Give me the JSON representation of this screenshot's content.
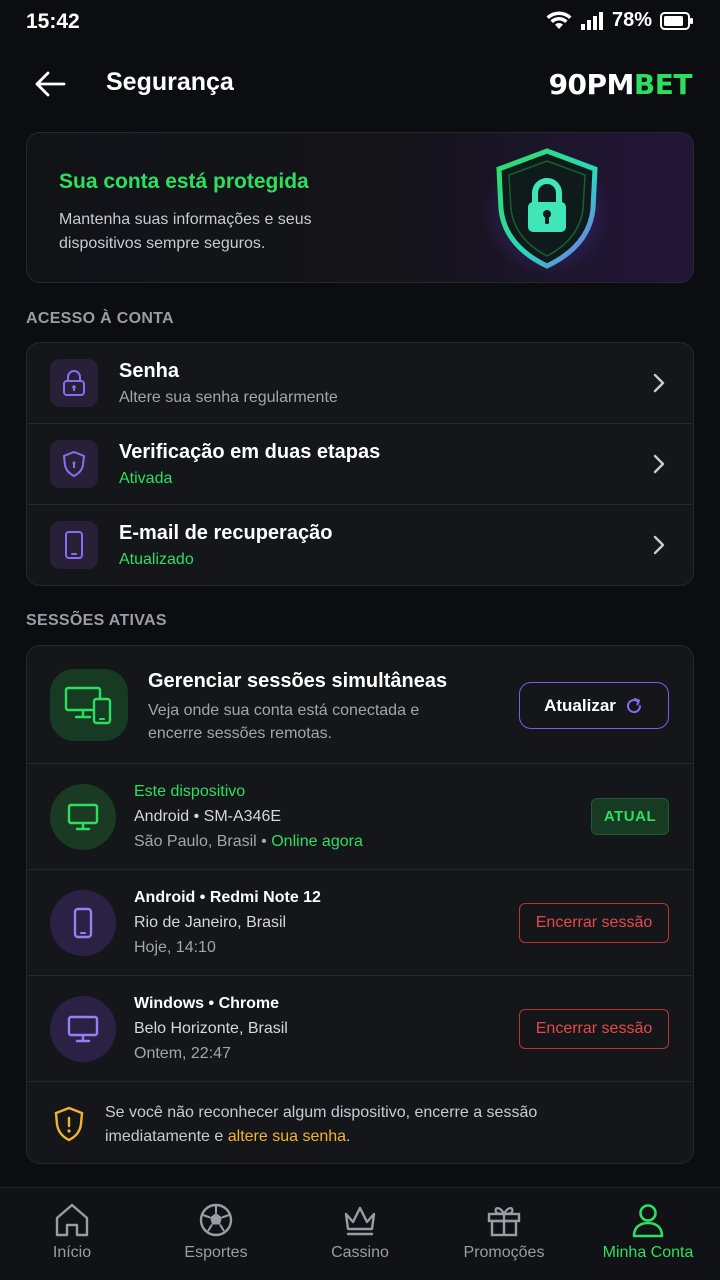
{
  "status_bar": {
    "time": "15:42",
    "battery": "78%"
  },
  "header": {
    "title": "Segurança",
    "logo_part1": "90PM",
    "logo_part2": "BET"
  },
  "hero": {
    "title": "Sua conta está protegida",
    "text": "Mantenha suas informações e seus dispositivos sempre seguros."
  },
  "account_access": {
    "label": "ACESSO À CONTA",
    "items": [
      {
        "title": "Senha",
        "subtitle": "Altere sua senha regularmente",
        "icon": "lock-icon"
      },
      {
        "title": "Verificação em duas etapas",
        "subtitle": "Ativada",
        "icon": "shield-lock-icon"
      },
      {
        "title": "E-mail de recuperação",
        "subtitle": "Atualizado",
        "icon": "phone-icon"
      }
    ]
  },
  "sessions": {
    "label": "SESSÕES ATIVAS",
    "manage_title": "Gerenciar sessões simultâneas",
    "manage_text": "Veja onde sua conta está conectada e encerre sessões remotas.",
    "refresh_label": "Atualizar",
    "current": {
      "tag": "Este dispositivo",
      "device": "Android • SM-A346E",
      "location": "São Paulo, Brasil",
      "separator": " • ",
      "status": "Online agora",
      "badge": "ATUAL"
    },
    "others": [
      {
        "device": "Android • Redmi Note 12",
        "location": "Rio de Janeiro, Brasil",
        "time": "Hoje, 14:10",
        "action": "Encerrar sessão"
      },
      {
        "device": "Windows • Chrome",
        "location": "Belo Horizonte, Brasil",
        "time": "Ontem, 22:47",
        "action": "Encerrar sessão"
      }
    ],
    "warning_text": "Se você não reconhecer algum dispositivo, encerre a sessão imediatamente e ",
    "warning_link": "altere sua senha",
    "warning_end": "."
  },
  "bottom_nav": {
    "items": [
      {
        "label": "Início",
        "icon": "home-icon"
      },
      {
        "label": "Esportes",
        "icon": "soccer-ball-icon"
      },
      {
        "label": "Cassino",
        "icon": "crown-icon"
      },
      {
        "label": "Promoções",
        "icon": "gift-icon"
      },
      {
        "label": "Minha Conta",
        "icon": "user-icon"
      }
    ],
    "active": "Minha Conta"
  },
  "colors": {
    "accent_green": "#2ddf5f",
    "accent_purple": "#7a5cf0",
    "danger": "#e54a4a",
    "warning": "#f2b32e"
  }
}
